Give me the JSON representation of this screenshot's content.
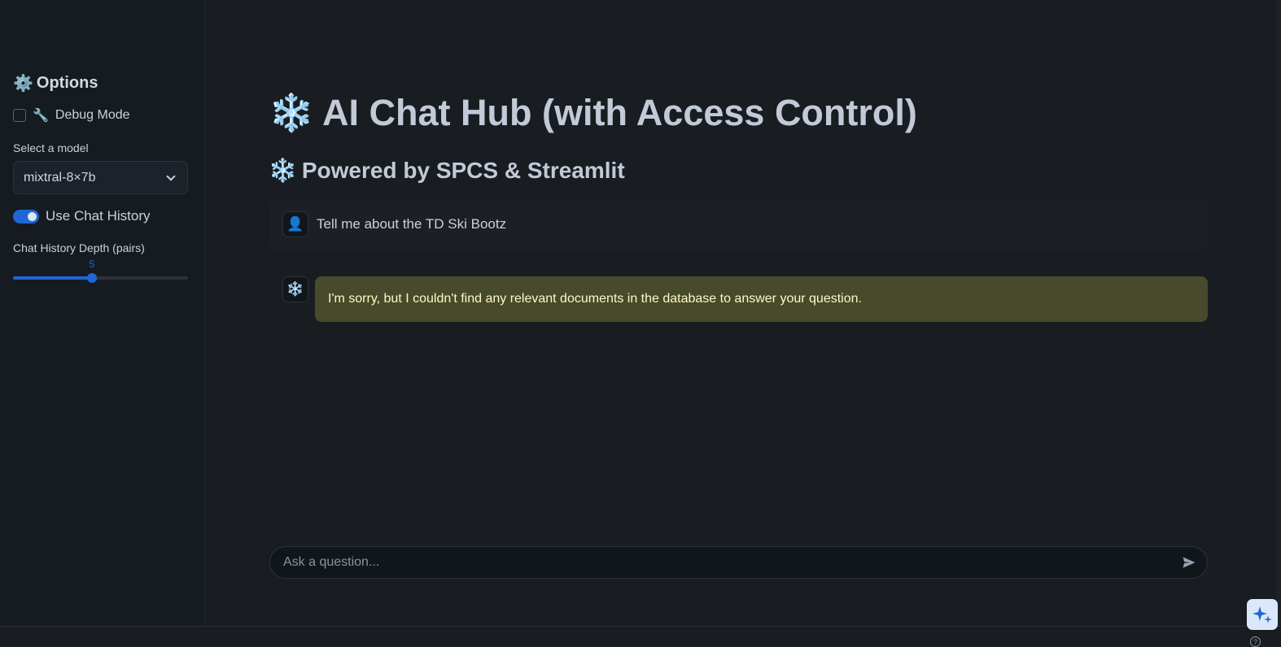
{
  "sidebar": {
    "title": "Options",
    "title_icon": "⚙️",
    "debug_icon": "🔧",
    "debug_label": "Debug Mode",
    "debug_checked": false,
    "model_label": "Select a model",
    "model_value": "mixtral-8×7b",
    "history_label": "Use Chat History",
    "history_enabled": true,
    "depth_label": "Chat History Depth (pairs)",
    "depth_value": "5",
    "depth_fraction": 0.45
  },
  "main": {
    "title_icon": "❄️",
    "title": "AI Chat Hub (with Access Control)",
    "subtitle_icon": "❄️",
    "subtitle": "Powered by SPCS & Streamlit"
  },
  "messages": {
    "user_avatar": "👤",
    "user_text": "Tell me about the TD Ski Bootz",
    "bot_avatar": "❄️",
    "bot_text": "I'm sorry, but I couldn't find any relevant documents in the database to answer your question."
  },
  "input": {
    "placeholder": "Ask a question..."
  },
  "colors": {
    "accent": "#1f66d6",
    "warning_bg": "#474a2b",
    "warning_text": "#fff9c2"
  }
}
